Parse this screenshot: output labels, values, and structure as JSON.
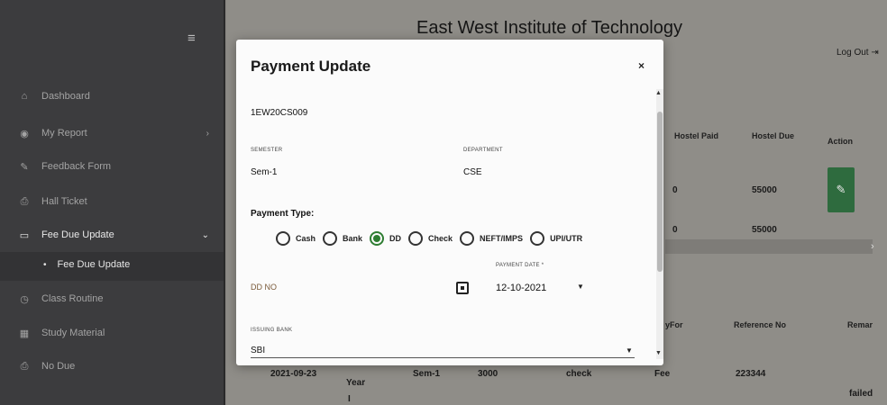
{
  "sidebar": {
    "items": [
      {
        "label": "Dashboard",
        "icon": "dashboard-icon",
        "glyph": "⌂"
      },
      {
        "label": "My Report",
        "icon": "report-icon",
        "glyph": "◉"
      },
      {
        "label": "Feedback Form",
        "icon": "feedback-icon",
        "glyph": "✎"
      },
      {
        "label": "Hall Ticket",
        "icon": "ticket-icon",
        "glyph": "⎙"
      },
      {
        "label": "Fee Due Update",
        "icon": "folder-icon",
        "glyph": "▭"
      },
      {
        "label": "Class Routine",
        "icon": "routine-icon",
        "glyph": "◷"
      },
      {
        "label": "Study Material",
        "icon": "book-icon",
        "glyph": "▦"
      },
      {
        "label": "No Due",
        "icon": "nodue-icon",
        "glyph": "⎙"
      }
    ],
    "sub_item": "Fee Due Update"
  },
  "header": {
    "title": "East West Institute of Technology",
    "logout": "Log Out"
  },
  "background_table": {
    "headers_top": [
      "Hostel Paid",
      "Hostel Due",
      "Action"
    ],
    "rows_top": [
      {
        "paid": "0",
        "due": "55000"
      },
      {
        "paid": "0",
        "due": "55000"
      }
    ],
    "headers_bottom": [
      "yFor",
      "Reference No",
      "Remar"
    ],
    "row_bottom": {
      "date": "2021-09-23",
      "year": "Year",
      "sem": "Sem-1",
      "amount": "3000",
      "mode": "check",
      "for": "Fee",
      "ref": "223344"
    },
    "partial_row": {
      "year": "I",
      "status": "failed"
    }
  },
  "modal": {
    "title": "Payment Update",
    "close": "×",
    "usn_value": "1EW20CS009",
    "semester_label": "SEMESTER",
    "semester_value": "Sem-1",
    "department_label": "DEPARTMENT",
    "department_value": "CSE",
    "payment_type_label": "Payment Type:",
    "payment_options": [
      "Cash",
      "Bank",
      "DD",
      "Check",
      "NEFT/IMPS",
      "UPI/UTR"
    ],
    "selected_payment": "DD",
    "dd_no_placeholder": "DD NO",
    "payment_date_label": "PAYMENT DATE *",
    "payment_date_value": "12-10-2021",
    "issuing_bank_label": "ISSUING BANK",
    "issuing_bank_value": "SBI"
  },
  "colors": {
    "accent_green": "#2e7d32",
    "action_button": "#2e6b3e",
    "sidebar": "#3c3c3e"
  }
}
